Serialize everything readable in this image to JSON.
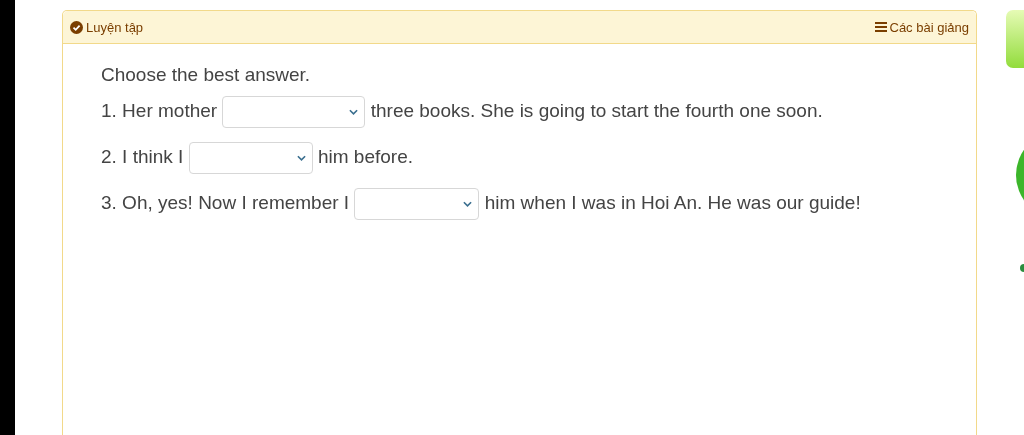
{
  "panel": {
    "title": "Luyện tập",
    "lessons_link": "Các bài giảng"
  },
  "instruction": "Choose the best answer.",
  "questions": [
    {
      "before": "1. Her mother",
      "after": "three books. She is going to start the fourth one soon."
    },
    {
      "before": "2. I think I",
      "after": "him before."
    },
    {
      "before": "3. Oh, yes! Now I remember I",
      "after": "him when I was in Hoi An. He was our guide!"
    }
  ]
}
